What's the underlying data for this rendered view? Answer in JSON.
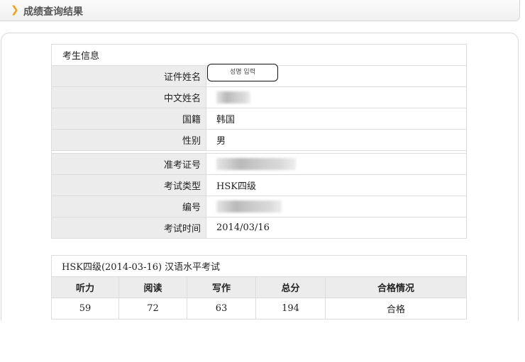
{
  "header": {
    "title": "成绩查询结果"
  },
  "candidate": {
    "section_title": "考生信息",
    "id_name_label": "证件姓名",
    "id_name_note": "성명 입력",
    "chinese_name_label": "中文姓名",
    "nationality_label": "国籍",
    "nationality_value": "韩国",
    "gender_label": "性别",
    "gender_value": "男",
    "admission_label": "准考证号",
    "exam_type_label": "考试类型",
    "exam_type_value": "HSK四级",
    "serial_label": "编号",
    "exam_date_label": "考试时间",
    "exam_date_value": "2014/03/16"
  },
  "scores": {
    "caption": "HSK四级(2014-03-16) 汉语水平考试",
    "headers": [
      "听力",
      "阅读",
      "写作",
      "总分",
      "合格情况"
    ],
    "values": [
      "59",
      "72",
      "63",
      "194",
      "合格"
    ]
  }
}
